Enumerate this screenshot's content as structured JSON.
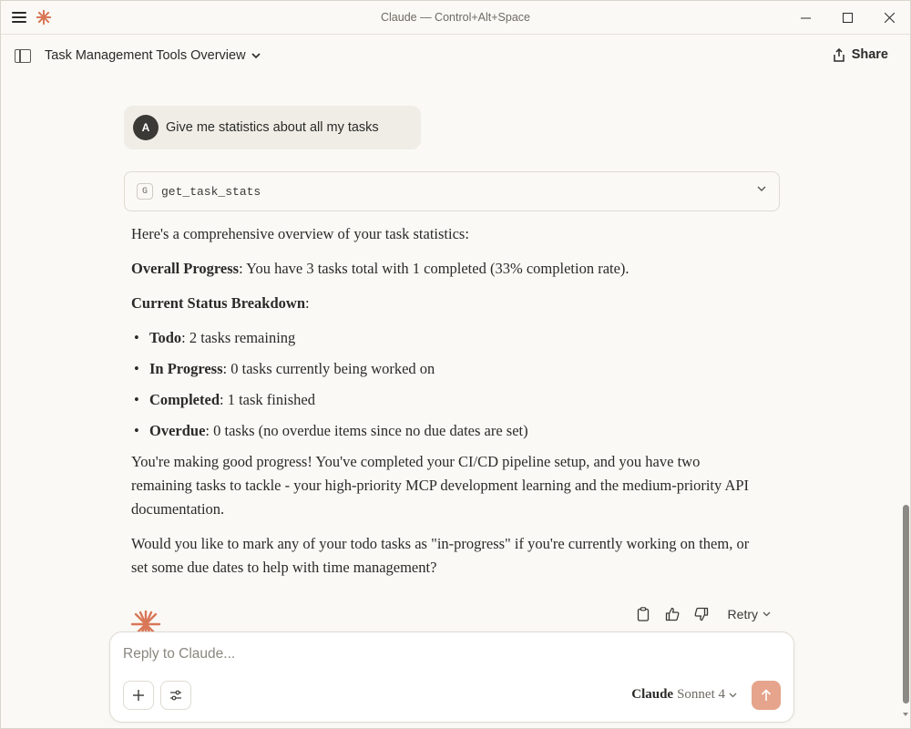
{
  "window": {
    "title": "Claude — Control+Alt+Space"
  },
  "header": {
    "conversation_title": "Task Management Tools Overview",
    "share_label": "Share"
  },
  "user_message": {
    "avatar_initial": "A",
    "text": "Give me statistics about all my tasks"
  },
  "tool_call": {
    "badge": "G",
    "name": "get_task_stats"
  },
  "response": {
    "intro": "Here's a comprehensive overview of your task statistics:",
    "overall_label": "Overall Progress",
    "overall_text": ": You have 3 tasks total with 1 completed (33% completion rate).",
    "breakdown_heading": "Current Status Breakdown",
    "breakdown_colon": ":",
    "items": [
      {
        "label": "Todo",
        "text": ": 2 tasks remaining"
      },
      {
        "label": "In Progress",
        "text": ": 0 tasks currently being worked on"
      },
      {
        "label": "Completed",
        "text": ": 1 task finished"
      },
      {
        "label": "Overdue",
        "text": ": 0 tasks (no overdue items since no due dates are set)"
      }
    ],
    "paragraph_1": "You're making good progress! You've completed your CI/CD pipeline setup, and you have two remaining tasks to tackle - your high-priority MCP development learning and the medium-priority API documentation.",
    "paragraph_2": "Would you like to mark any of your todo tasks as \"in-progress\" if you're currently working on them, or set some due dates to help with time management?"
  },
  "message_actions": {
    "retry_label": "Retry"
  },
  "composer": {
    "placeholder": "Reply to Claude...",
    "model_brand": "Claude",
    "model_version": "Sonnet 4"
  },
  "colors": {
    "accent": "#d97757",
    "send_button": "#e5a48b",
    "background": "#faf9f5"
  }
}
